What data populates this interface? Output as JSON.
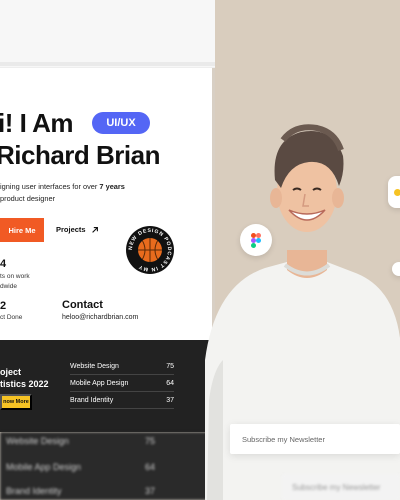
{
  "hero": {
    "line1": "i! I Am",
    "line2": "Richard Brian",
    "badge": "UI/UX",
    "desc_line1_pre": "igning user interfaces for over ",
    "desc_years": "7 years",
    "desc_line2": "product designer",
    "hire_label": "Hire Me",
    "projects_label": "Projects"
  },
  "stats": {
    "num1": "4",
    "label1_line1": "ts on work",
    "label1_line2": "dwide",
    "num2": "2",
    "label2": "ct Done"
  },
  "contact": {
    "title": "Contact",
    "email": "heloo@richardbrian.com"
  },
  "podcast": {
    "ring_text": "NEW DESIGN PODCAST IN MY"
  },
  "project_stats": {
    "title_line1": "oject",
    "title_line2": "tistics 2022",
    "button_label": "now More",
    "rows": [
      {
        "label": "Website Design",
        "value": "75"
      },
      {
        "label": "Mobile App Design",
        "value": "64"
      },
      {
        "label": "Brand Identity",
        "value": "37"
      }
    ]
  },
  "reflection": {
    "rows": [
      {
        "label": "Website Design",
        "value": "75"
      },
      {
        "label": "Mobile App Design",
        "value": "64"
      },
      {
        "label": "Brand Identity",
        "value": "37"
      }
    ]
  },
  "newsletter": {
    "placeholder": "Subscribe my Newsletter",
    "blur_placeholder": "Subscribe my Newsletter"
  },
  "colors": {
    "accent_blue": "#5466f5",
    "accent_orange": "#f15a24",
    "accent_yellow": "#f6c324",
    "dark_bg": "#222222",
    "beige_bg": "#d9cdbe"
  },
  "icons": {
    "figma": "figma-icon",
    "arrow": "arrow-up-right-icon",
    "basketball": "basketball-icon"
  }
}
